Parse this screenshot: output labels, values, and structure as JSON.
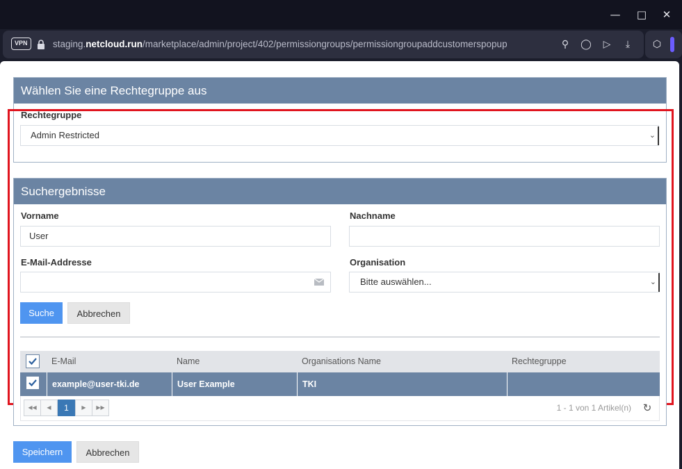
{
  "browser": {
    "vpn_label": "VPN",
    "url_prefix": "staging.",
    "url_domain": "netcloud.run",
    "url_path": "/marketplace/admin/project/402/permissiongroups/permissiongroupaddcustomerspopup"
  },
  "group_panel": {
    "title": "Wählen Sie eine Rechtegruppe aus",
    "label": "Rechtegruppe",
    "selected": "Admin Restricted"
  },
  "search_panel": {
    "title": "Suchergebnisse",
    "firstname_label": "Vorname",
    "firstname_value": "User",
    "lastname_label": "Nachname",
    "lastname_value": "",
    "email_label": "E-Mail-Addresse",
    "email_value": "",
    "org_label": "Organisation",
    "org_selected": "Bitte auswählen...",
    "search_button": "Suche",
    "cancel_button": "Abbrechen"
  },
  "grid": {
    "columns": [
      "E-Mail",
      "Name",
      "Organisations Name",
      "Rechtegruppe"
    ],
    "rows": [
      {
        "email": "example@user-tki.de",
        "name": "User Example",
        "organisation": "TKI",
        "group": "",
        "checked": true
      }
    ],
    "current_page": "1",
    "pager_info": "1 - 1 von 1 Artikel(n)"
  },
  "footer": {
    "save_button": "Speichern",
    "cancel_button": "Abbrechen"
  },
  "colors": {
    "panel_header": "#6b84a3",
    "primary_button": "#4f95f0",
    "highlight_frame": "#e0141e"
  }
}
